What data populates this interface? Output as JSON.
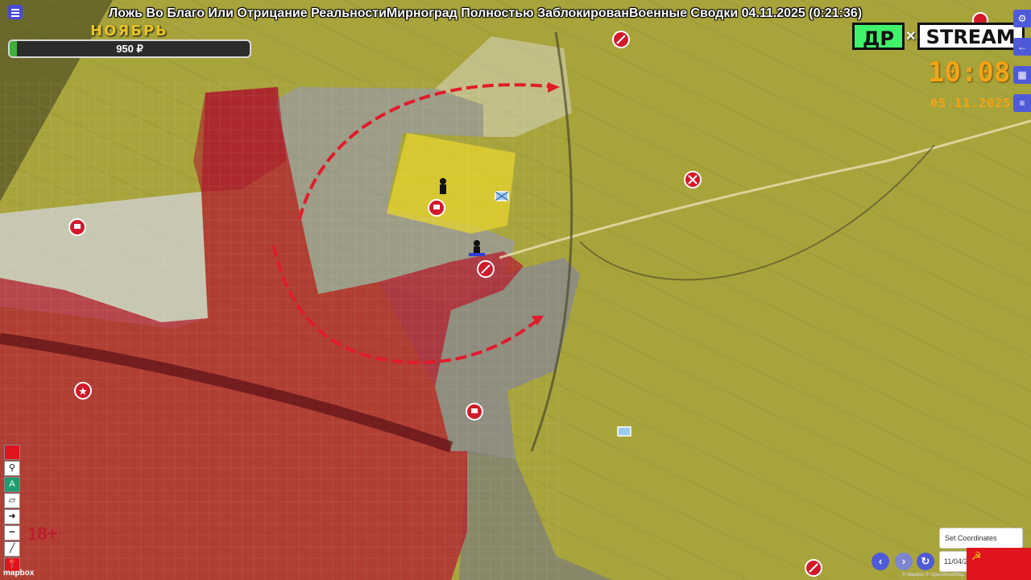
{
  "stream": {
    "title": "Ложь Во Благо Или Отрицание РеальностиМирноград Полностью ЗаблокированВоенные Сводки 04.11.2025 (0:21:36)",
    "month": "НОЯБРЬ",
    "donation_amount": "950 ₽",
    "donation_progress": 0.03
  },
  "logo": {
    "left": "ДР",
    "x": "×",
    "right": "STREAM"
  },
  "clock": {
    "time": "10:08",
    "date": "05.11.2025"
  },
  "right_buttons": [
    {
      "name": "settings-icon",
      "glyph": "⚙"
    },
    {
      "name": "arrow-left-icon",
      "glyph": "←"
    },
    {
      "name": "calendar-icon",
      "glyph": "▦"
    },
    {
      "name": "list-icon",
      "glyph": "≡"
    }
  ],
  "tools": [
    {
      "name": "red-square-tool-icon",
      "glyph": "■"
    },
    {
      "name": "pin-tool-icon",
      "glyph": "⚲"
    },
    {
      "name": "marker-tool-icon",
      "glyph": "A"
    },
    {
      "name": "polygon-tool-icon",
      "glyph": "▱"
    },
    {
      "name": "arrow-tool-icon",
      "glyph": "➜"
    },
    {
      "name": "dash-line-tool-icon",
      "glyph": "┅"
    },
    {
      "name": "line-tool-icon",
      "glyph": "╱"
    },
    {
      "name": "red-pin-tool-icon",
      "glyph": "📍"
    }
  ],
  "age_rating": "18+",
  "map": {
    "attribution_mapbox": "mapbox",
    "attribution_osm": "© Mapbox © OpenStreetMap",
    "set_coordinates_placeholder": "Set Coordinates",
    "date_value": "11/04/2",
    "colors": {
      "russian_control": "#b2212f",
      "ukrainian_control": "#c9c23a",
      "contested": "#c8c8c8",
      "arrow": "#e21b2b"
    }
  },
  "flag_glyph": "☭"
}
